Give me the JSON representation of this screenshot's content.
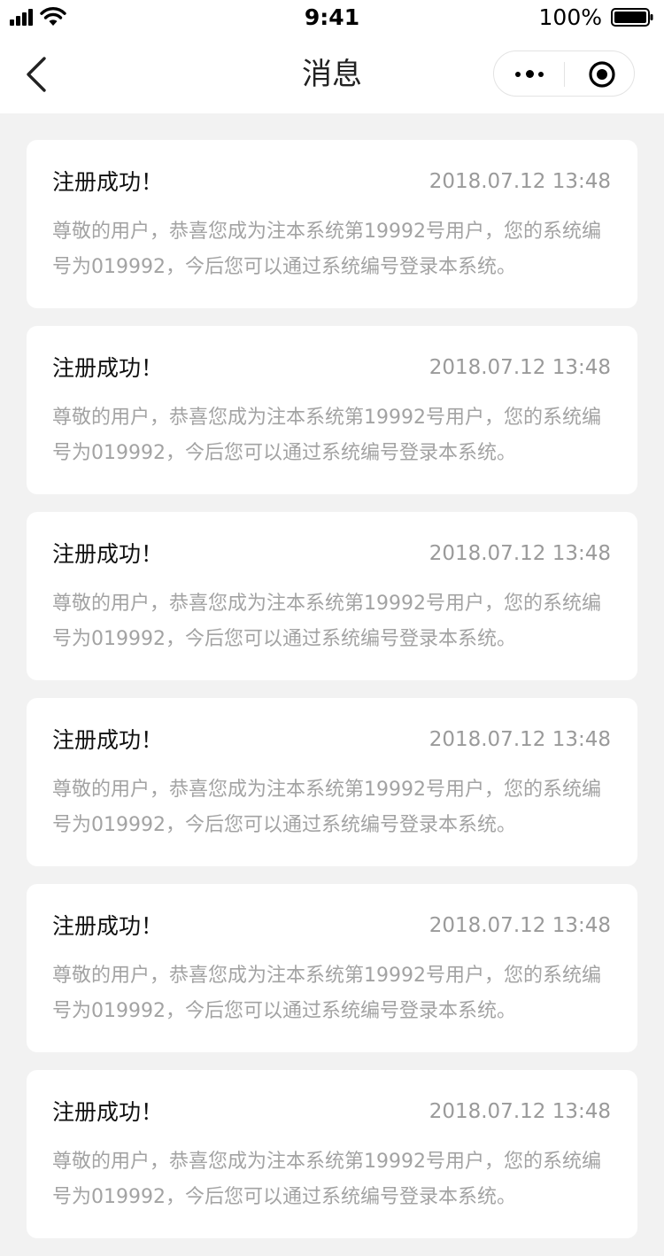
{
  "status_bar": {
    "time": "9:41",
    "battery_percent": "100%",
    "icons": [
      "cellular-signal-icon",
      "wifi-icon",
      "battery-icon"
    ]
  },
  "nav": {
    "title": "消息",
    "icons": [
      "back-arrow-icon",
      "more-dots-icon",
      "close-circle-icon"
    ]
  },
  "messages": [
    {
      "title": "注册成功！",
      "time": "2018.07.12 13:48",
      "body": "尊敬的用户，恭喜您成为注本系统第19992号用户，您的系统编号为019992，今后您可以通过系统编号登录本系统。"
    },
    {
      "title": "注册成功！",
      "time": "2018.07.12 13:48",
      "body": "尊敬的用户，恭喜您成为注本系统第19992号用户，您的系统编号为019992，今后您可以通过系统编号登录本系统。"
    },
    {
      "title": "注册成功！",
      "time": "2018.07.12 13:48",
      "body": "尊敬的用户，恭喜您成为注本系统第19992号用户，您的系统编号为019992，今后您可以通过系统编号登录本系统。"
    },
    {
      "title": "注册成功！",
      "time": "2018.07.12 13:48",
      "body": "尊敬的用户，恭喜您成为注本系统第19992号用户，您的系统编号为019992，今后您可以通过系统编号登录本系统。"
    },
    {
      "title": "注册成功！",
      "time": "2018.07.12 13:48",
      "body": "尊敬的用户，恭喜您成为注本系统第19992号用户，您的系统编号为019992，今后您可以通过系统编号登录本系统。"
    },
    {
      "title": "注册成功！",
      "time": "2018.07.12 13:48",
      "body": "尊敬的用户，恭喜您成为注本系统第19992号用户，您的系统编号为019992，今后您可以通过系统编号登录本系统。"
    }
  ],
  "colors": {
    "page_background": "#f2f2f2",
    "card_background": "#ffffff",
    "title_text": "#111111",
    "secondary_text": "#9a9a9a"
  }
}
